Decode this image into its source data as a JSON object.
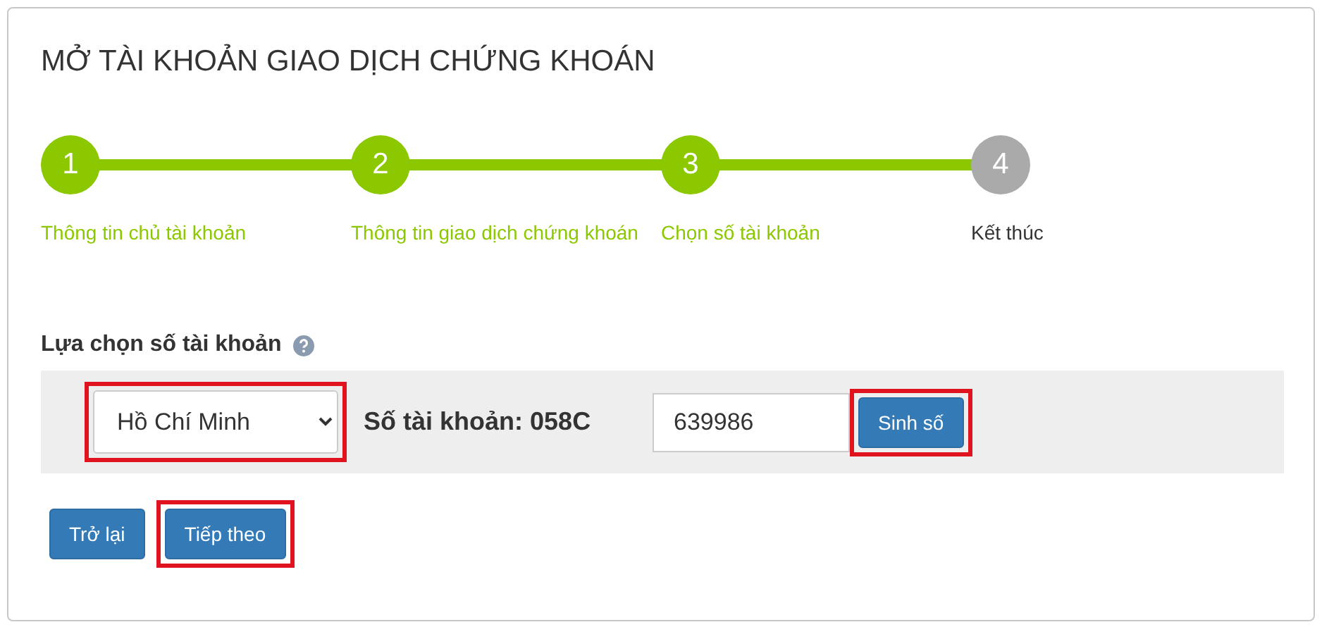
{
  "title": "MỞ TÀI KHOẢN GIAO DỊCH CHỨNG KHOÁN",
  "steps": [
    {
      "number": "1",
      "label": "Thông tin chủ tài khoản",
      "done": true
    },
    {
      "number": "2",
      "label": "Thông tin giao dịch chứng khoán",
      "done": true
    },
    {
      "number": "3",
      "label": "Chọn số tài khoản",
      "done": true
    },
    {
      "number": "4",
      "label": "Kết thúc",
      "done": false
    }
  ],
  "section_label": "Lựa chọn số tài khoản",
  "branch_select": {
    "value": "Hồ Chí Minh",
    "highlighted": true
  },
  "account_prefix": {
    "label": "Số tài khoản:",
    "value": "058C"
  },
  "account_number": {
    "value": "639986"
  },
  "generate_button": {
    "label": "Sinh số",
    "highlighted": true
  },
  "buttons": [
    {
      "label": "Trở lại",
      "highlighted": false
    },
    {
      "label": "Tiếp theo",
      "highlighted": true
    }
  ]
}
